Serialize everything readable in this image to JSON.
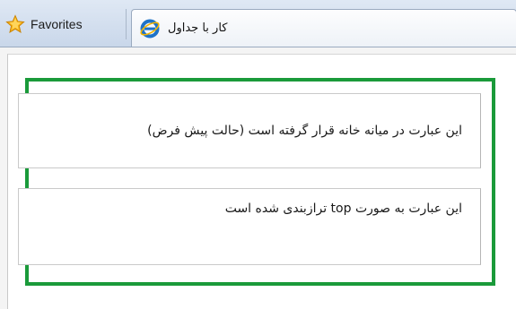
{
  "toolbar": {
    "favorites_label": "Favorites",
    "favorites_icon": "star-icon"
  },
  "tab": {
    "title": "کار با جداول",
    "icon": "internet-explorer-icon"
  },
  "table": {
    "border_color": "#1a9a3a",
    "cells": [
      {
        "text": "این عبارت در میانه خانه قرار گرفته است (حالت پیش فرض)",
        "valign": "middle"
      },
      {
        "text": "این عبارت به صورت top ترازبندی شده است",
        "valign": "top"
      }
    ]
  }
}
